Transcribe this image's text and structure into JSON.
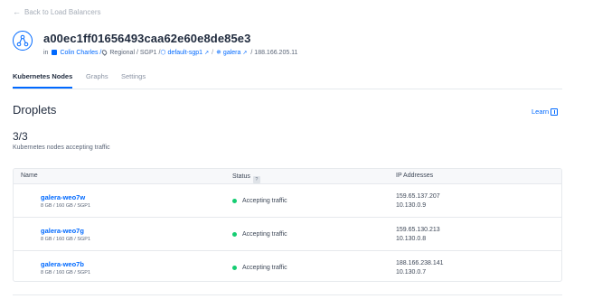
{
  "back_link": "Back to Load Balancers",
  "header": {
    "title": "a00ec1ff01656493caa62e60e8de85e3",
    "in_label": "in",
    "owner": "Colin Charles /",
    "region": "Regional / SGP1 /",
    "vpc": "default-sgp1",
    "cluster": "galera",
    "slash": "/",
    "ip": "/ 188.166.205.11"
  },
  "tabs": [
    "Kubernetes Nodes",
    "Graphs",
    "Settings"
  ],
  "section": {
    "title": "Droplets",
    "learn": "Learn"
  },
  "summary": {
    "count": "3/3",
    "label": "Kubernetes nodes accepting traffic"
  },
  "table": {
    "columns": [
      "Name",
      "Status",
      "IP Addresses"
    ],
    "help": "?",
    "rows": [
      {
        "name": "galera-weo7w",
        "spec": "8 GB / 160 GB / SGP1",
        "status": "Accepting traffic",
        "ip_public": "159.65.137.207",
        "ip_private": "10.130.0.9"
      },
      {
        "name": "galera-weo7g",
        "spec": "8 GB / 160 GB / SGP1",
        "status": "Accepting traffic",
        "ip_public": "159.65.130.213",
        "ip_private": "10.130.0.8"
      },
      {
        "name": "galera-weo7b",
        "spec": "8 GB / 160 GB / SGP1",
        "status": "Accepting traffic",
        "ip_public": "188.166.238.141",
        "ip_private": "10.130.0.7"
      }
    ]
  },
  "colors": {
    "accent": "#0069ff",
    "status_ok": "#15cd72"
  }
}
